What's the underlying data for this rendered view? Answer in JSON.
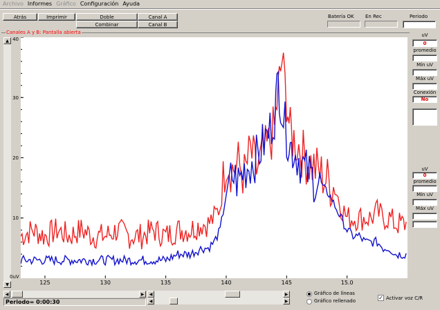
{
  "menu": [
    "Archivo",
    "Informes",
    "Gráfico",
    "Configuración",
    "Ayuda"
  ],
  "menu_disabled": [
    true,
    false,
    true,
    false,
    false
  ],
  "toolbar": {
    "atras": "Atrás",
    "imprimir": "Imprimir",
    "doble": "Doble",
    "combinar": "Combinar",
    "canal_a": "Canal A",
    "canal_b": "Canal B"
  },
  "status": {
    "bateria": "Batería OK",
    "en_rec": "En Rec",
    "periodo": "Periodo"
  },
  "group_title": "Canales A y B: Pantalla abierta",
  "side_a": {
    "unit": "uV",
    "value": "0",
    "promedio": "promedio",
    "min": "Mín uV",
    "max": "Máx uV",
    "conexion": "Conexión",
    "conexion_value": "No"
  },
  "side_b": {
    "unit": "uV",
    "value": "0",
    "promedio": "promedio",
    "min": "Mín uV",
    "max": "Máx uV"
  },
  "bottom": {
    "periodo": "Periodo= 0:00:30",
    "grafico_lineas": "Gráfico de líneas",
    "grafico_rellenado": "Gráfico rellenado",
    "activar_voz": "Activar voz C/R"
  },
  "colors": {
    "channel_a": "#ee2222",
    "channel_b": "#1111cc"
  },
  "chart_data": {
    "type": "line",
    "title": "",
    "xlabel": "",
    "ylabel": "",
    "y_unit_label": "0uV",
    "xlim": [
      123,
      155
    ],
    "ylim": [
      0,
      40
    ],
    "x_ticks": [
      "125",
      "130",
      "135",
      "140",
      "145",
      "15.0"
    ],
    "x_tick_positions": [
      125,
      130,
      135,
      140,
      145,
      150
    ],
    "y_ticks": [
      "40",
      "30",
      "20",
      "10"
    ],
    "y_tick_values": [
      40,
      30,
      20,
      10
    ],
    "series": [
      {
        "color": "#ee2222",
        "x": [
          123,
          124,
          125,
          126,
          127,
          128,
          129,
          130,
          131,
          132,
          133,
          134,
          135,
          136,
          137,
          138,
          138.5,
          139,
          139.5,
          140,
          140.5,
          141,
          141.5,
          142,
          142.5,
          143,
          143.5,
          144,
          144.3,
          144.6,
          145,
          145.3,
          145.6,
          146,
          146.5,
          147,
          147.5,
          148,
          148.5,
          149,
          149.5,
          150,
          150.5,
          151,
          151.5,
          152,
          152.5,
          153,
          153.5,
          154,
          155
        ],
        "y": [
          7,
          8,
          7,
          8,
          7,
          8,
          7,
          7,
          8,
          7,
          7,
          8,
          7,
          8,
          8,
          9,
          9,
          10,
          12,
          20,
          18,
          19,
          17,
          21,
          18,
          20,
          22,
          25,
          31,
          36,
          30,
          24,
          23,
          22,
          20,
          19,
          18,
          17,
          16,
          15,
          12,
          10,
          10,
          10,
          10,
          10,
          11,
          10,
          10,
          9,
          9
        ]
      },
      {
        "color": "#1111cc",
        "x": [
          123,
          124,
          125,
          126,
          127,
          128,
          129,
          130,
          131,
          132,
          133,
          134,
          135,
          136,
          137,
          138,
          138.5,
          139,
          139.5,
          140,
          140.5,
          141,
          141.5,
          142,
          142.5,
          143,
          143.5,
          144,
          144.3,
          144.6,
          145,
          145.3,
          145.6,
          146,
          146.5,
          147,
          147.5,
          148,
          148.5,
          149,
          149.5,
          150,
          150.5,
          151,
          151.5,
          152,
          152.5,
          153,
          153.5,
          154,
          155
        ],
        "y": [
          3,
          3,
          3,
          3,
          3,
          3,
          3,
          3,
          3,
          3,
          3,
          3,
          3,
          4,
          4,
          5,
          5,
          6,
          8,
          14,
          17,
          16,
          18,
          19,
          20,
          22,
          24,
          27,
          33,
          28,
          24,
          22,
          21,
          20,
          18,
          17,
          16,
          15,
          14,
          12,
          10,
          8,
          7,
          7,
          6,
          6,
          6,
          5,
          5,
          4,
          4
        ]
      }
    ]
  }
}
